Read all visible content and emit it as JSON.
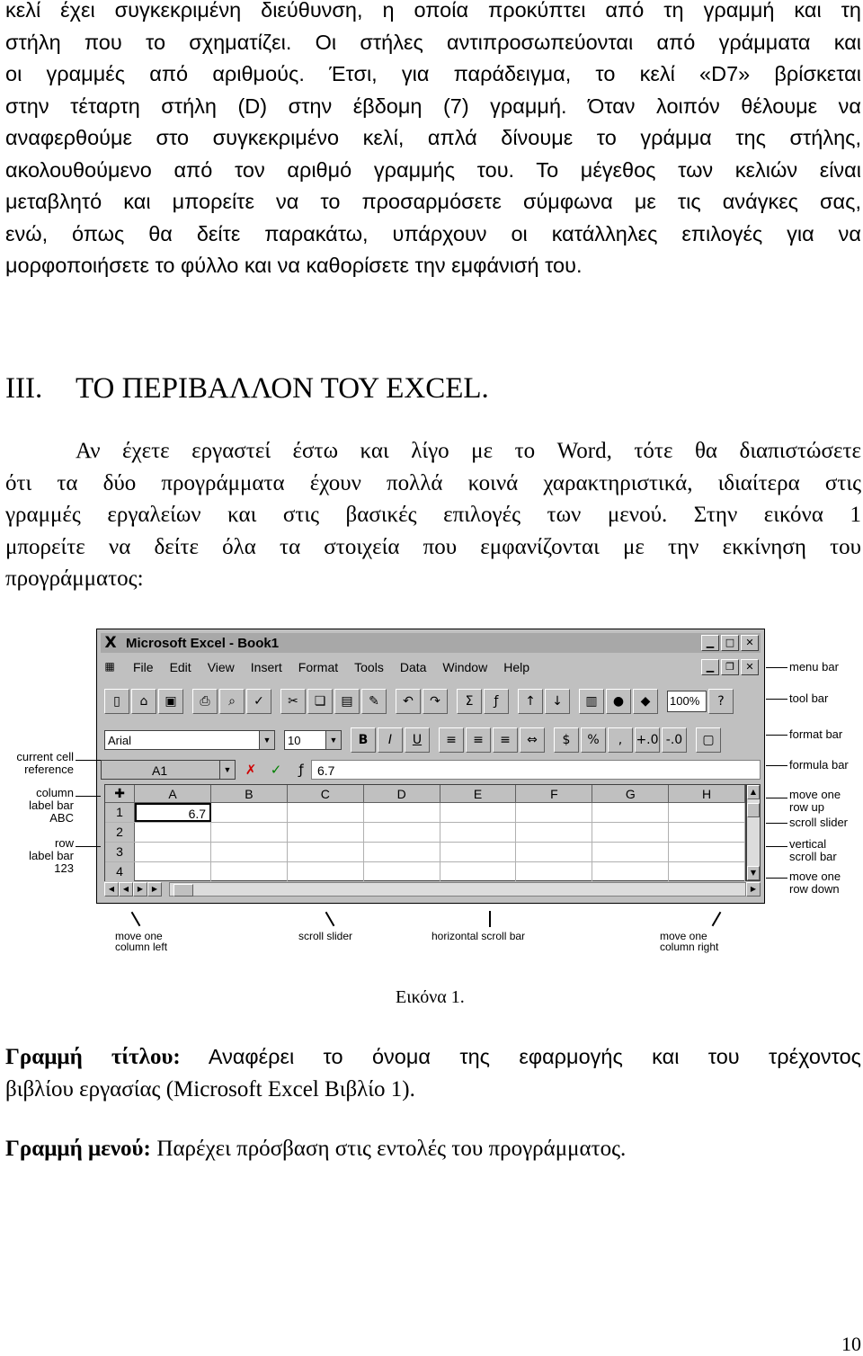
{
  "intro": {
    "lines": [
      "κελί έχει συγκεκριμένη διεύθυνση, η οποία προκύπτει από τη γραμμή και τη",
      "στήλη που το σχηματίζει. Οι στήλες αντιπροσωπεύονται από γράμματα και",
      "οι γραμμές από αριθμούς. Έτσι, για παράδειγμα, το κελί «D7» βρίσκεται",
      "στην τέταρτη στήλη (D) στην έβδομη (7) γραμμή. Όταν λοιπόν θέλουμε να",
      "αναφερθούμε στο συγκεκριμένο κελί, απλά δίνουμε το γράμμα της στήλης,",
      "ακολουθούμενο από τον αριθμό γραμμής του. Το μέγεθος των κελιών είναι",
      "μεταβλητό και μπορείτε να το προσαρμόσετε σύμφωνα με τις ανάγκες σας,",
      "ενώ, όπως θα δείτε παρακάτω, υπάρχουν οι κατάλληλες επιλογές για να",
      "μορφοποιήσετε το φύλλο και να καθορίσετε την εμφάνισή του."
    ]
  },
  "section": {
    "number": "III.",
    "title": "ΤΟ ΠΕΡΙΒΑΛΛΟΝ ΤΟΥ EXCEL."
  },
  "para2": {
    "lines": [
      "Αν έχετε εργαστεί έστω και λίγο με το Word, τότε θα διαπιστώσετε",
      "ότι τα δύο προγράμματα έχουν πολλά κοινά χαρακτηριστικά, ιδιαίτερα στις",
      "γραμμές εργαλείων και στις βασικές επιλογές των μενού. Στην εικόνα 1",
      "μπορείτε να δείτε όλα τα στοιχεία που εμφανίζονται με την εκκίνηση του",
      "προγράμματος:"
    ]
  },
  "figure": {
    "window_title": "Microsoft Excel - Book1",
    "title_logo": "X",
    "menu": [
      "File",
      "Edit",
      "View",
      "Insert",
      "Format",
      "Tools",
      "Data",
      "Window",
      "Help"
    ],
    "zoom": "100%",
    "font_name": "Arial",
    "font_size": "10",
    "name_box": "A1",
    "formula_value": "6.7",
    "columns": [
      "A",
      "B",
      "C",
      "D",
      "E",
      "F",
      "G",
      "H"
    ],
    "rows": [
      "1",
      "2",
      "3",
      "4"
    ],
    "cell_a1": "6.7",
    "callouts_right": {
      "menu_bar": "menu bar",
      "tool_bar": "tool bar",
      "format_bar": "format bar",
      "formula_bar": "formula bar",
      "move_row_up": "move one\nrow up",
      "scroll_slider": "scroll slider",
      "vertical_scroll_bar": "vertical\nscroll bar",
      "move_row_down": "move one\nrow down"
    },
    "callouts_left": {
      "current_cell_reference": "current cell\nreference",
      "column_label_bar": "column\nlabel bar\nABC",
      "row_label_bar": "row\nlabel bar\n123"
    },
    "callouts_bottom": {
      "move_column_left": "move one\ncolumn left",
      "scroll_slider": "scroll slider",
      "horizontal_scroll_bar": "horizontal scroll bar",
      "move_column_right": "move one\ncolumn right"
    },
    "caption": "Εικόνα 1."
  },
  "definitions": {
    "title_bar_term": "Γραμμή τίτλου:",
    "title_bar_line1": "Αναφέρει το όνομα της εφαρμογής και του τρέχοντος",
    "title_bar_line2": "βιβλίου εργασίας (Microsoft Excel  Βιβλίο 1).",
    "menu_bar_term": "Γραμμή μενού:",
    "menu_bar_text": "Παρέχει πρόσβαση στις εντολές του προγράμματος."
  },
  "page_number": "10"
}
